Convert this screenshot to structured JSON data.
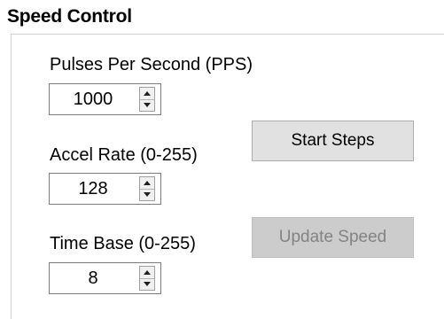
{
  "group": {
    "title": "Speed Control"
  },
  "fields": {
    "pps": {
      "label": "Pulses Per Second (PPS)",
      "value": "1000"
    },
    "accel": {
      "label": "Accel Rate (0-255)",
      "value": "128"
    },
    "timebase": {
      "label": "Time Base (0-255)",
      "value": "8"
    }
  },
  "buttons": {
    "start": {
      "label": "Start Steps",
      "enabled": true
    },
    "update": {
      "label": "Update Speed",
      "enabled": false
    }
  },
  "icons": {
    "up": "spin-up-arrow-icon",
    "down": "spin-down-arrow-icon"
  },
  "colors": {
    "button_face": "#e1e1e1",
    "button_disabled_face": "#cccccc",
    "button_disabled_text": "#838383",
    "group_border": "#d2d2d2"
  }
}
